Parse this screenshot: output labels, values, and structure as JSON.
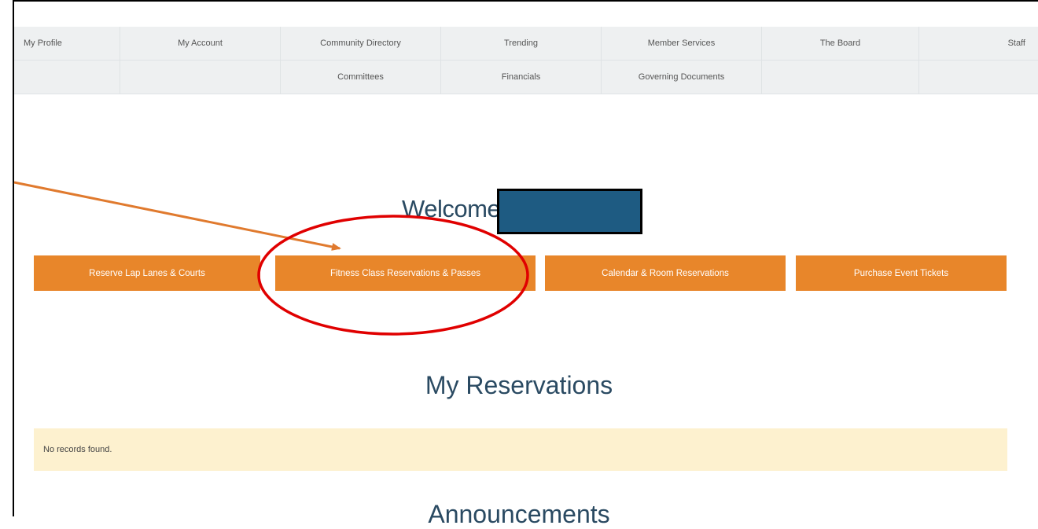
{
  "nav": {
    "row1": [
      "My Profile",
      "My Account",
      "Community Directory",
      "Trending",
      "Member Services",
      "The Board",
      "Staff"
    ],
    "row2": [
      "",
      "",
      "Committees",
      "Financials",
      "Governing Documents",
      "",
      ""
    ]
  },
  "welcome": {
    "text": "Welcome"
  },
  "actions": [
    "Reserve Lap Lanes & Courts",
    "Fitness Class Reservations & Passes",
    "Calendar & Room Reservations",
    "Purchase Event Tickets"
  ],
  "reservations": {
    "title": "My Reservations",
    "empty_text": "No records found."
  },
  "announcements": {
    "title": "Announcements"
  },
  "colors": {
    "accent": "#e8862a",
    "heading": "#2a4a62",
    "empty_bg": "#fdf1cf",
    "annotation_circle": "#e00000",
    "annotation_arrow": "#e07a2e",
    "redaction": "#1e5b82"
  }
}
